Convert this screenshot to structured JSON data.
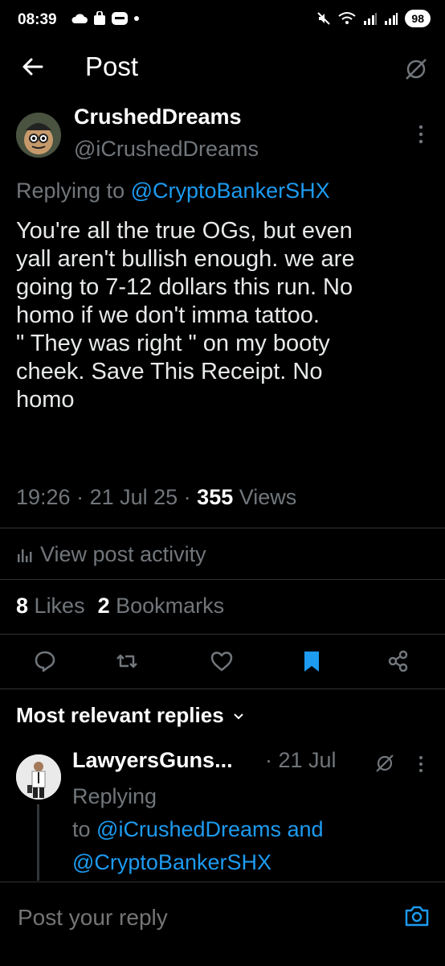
{
  "status_bar": {
    "time": "08:39",
    "battery": "98",
    "left_icons": [
      "cloud-icon",
      "shopping-bag-icon",
      "app-badge-icon",
      "dot-icon"
    ],
    "right_icons": [
      "mute-icon",
      "wifi-6e-icon",
      "signal-icon",
      "signal-r-icon"
    ]
  },
  "header": {
    "title": "Post",
    "back_icon": "arrow-left-icon",
    "grok_icon": "grok-icon"
  },
  "post": {
    "author_name": "CrushedDreams",
    "author_handle": "@iCrushedDreams",
    "replying_prefix": "Replying to ",
    "replying_to": "@CryptoBankerSHX",
    "text": "You're all the true OGs, but even\nyall aren't bullish enough. we are\ngoing to 7-12 dollars this run. No\nhomo if we don't imma tattoo.\n\" They was right \" on my booty\ncheek. Save This Receipt. No\nhomo",
    "time": "19:26",
    "date": "21 Jul 25",
    "views_count": "355",
    "views_label": "Views",
    "activity_label": "View post activity",
    "likes_count": "8",
    "likes_label": "Likes",
    "bookmarks_count": "2",
    "bookmarks_label": "Bookmarks"
  },
  "actions": [
    "reply-icon",
    "repost-icon",
    "like-icon",
    "bookmark-icon",
    "share-icon"
  ],
  "colors": {
    "accent": "#1d9bf0",
    "muted": "#71767b",
    "background": "#000000",
    "text": "#e7e9ea"
  },
  "replies": {
    "header": "Most relevant replies",
    "items": [
      {
        "name": "LawyersGuns...",
        "time": "21 Jul",
        "replying_prefix": "Replying",
        "replying_to_prefix": "to ",
        "replying_to_1": "@iCrushedDreams",
        "replying_and": " and",
        "replying_to_2": "@CryptoBankerSHX"
      }
    ]
  },
  "composer": {
    "placeholder": "Post your reply"
  }
}
